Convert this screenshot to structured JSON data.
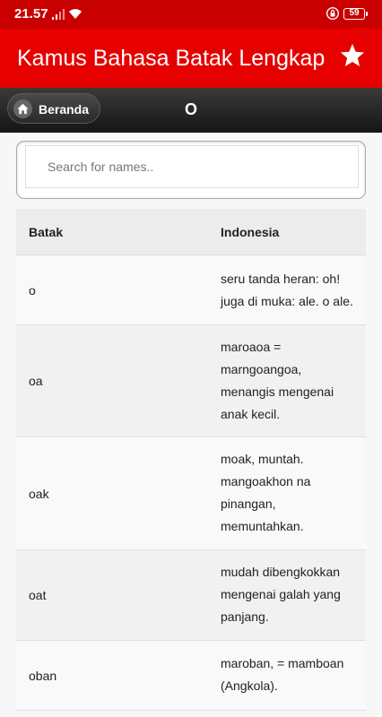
{
  "statusbar": {
    "time": "21.57",
    "battery": "59",
    "icons": [
      "signal-icon",
      "wifi-icon",
      "lock-icon",
      "battery-icon"
    ]
  },
  "appbar": {
    "title": "Kamus Bahasa Batak Lengkap",
    "favorite_icon": "star-icon"
  },
  "navbar": {
    "home_label": "Beranda",
    "home_icon": "home-icon",
    "letter": "O"
  },
  "search": {
    "placeholder": "Search for names..",
    "value": ""
  },
  "table": {
    "headers": [
      "Batak",
      "Indonesia"
    ],
    "rows": [
      {
        "batak": "o",
        "indonesia": [
          "seru tanda heran: oh!",
          "juga di muka: ale. o ale."
        ]
      },
      {
        "batak": "oa",
        "indonesia": [
          "maroaoa =",
          "marngoangoa,",
          "menangis mengenai",
          "anak kecil."
        ]
      },
      {
        "batak": "oak",
        "indonesia": [
          "moak, muntah.",
          "mangoakhon na",
          "pinangan,",
          "memuntahkan."
        ]
      },
      {
        "batak": "oat",
        "indonesia": [
          "mudah dibengkokkan",
          "mengenai galah yang",
          "panjang."
        ]
      },
      {
        "batak": "oban",
        "indonesia": [
          "maroban, = mamboan",
          "(Angkola)."
        ]
      }
    ]
  },
  "colors": {
    "statusbar": "#c80000",
    "appbar": "#e60000",
    "navbar": "#1f1f1f"
  }
}
